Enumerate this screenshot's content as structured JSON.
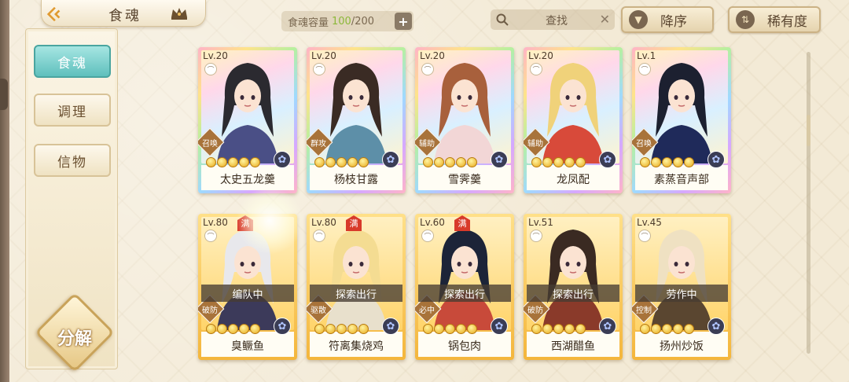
{
  "header": {
    "title": "食魂",
    "capacity_label": "食魂容量",
    "capacity_current": "100",
    "capacity_max": "/200",
    "search_placeholder": "查找",
    "sort_order_label": "降序",
    "sort_by_label": "稀有度"
  },
  "sidebar": {
    "tabs": [
      {
        "label": "食魂",
        "active": true
      },
      {
        "label": "调理",
        "active": false
      },
      {
        "label": "信物",
        "active": false
      }
    ],
    "decompose_label": "分解"
  },
  "cards": [
    {
      "name": "太史五龙羹",
      "level": "Lv.20",
      "role": "召唤",
      "frame": "rainbow",
      "stars": 5,
      "status": "",
      "full": false
    },
    {
      "name": "杨枝甘露",
      "level": "Lv.20",
      "role": "群攻",
      "frame": "rainbow",
      "stars": 5,
      "status": "",
      "full": false
    },
    {
      "name": "雪霁羹",
      "level": "Lv.20",
      "role": "辅助",
      "frame": "rainbow",
      "stars": 5,
      "status": "",
      "full": false
    },
    {
      "name": "龙凤配",
      "level": "Lv.20",
      "role": "辅助",
      "frame": "rainbow",
      "stars": 5,
      "status": "",
      "full": false
    },
    {
      "name": "素蒸音声部",
      "level": "Lv.1",
      "role": "召唤",
      "frame": "rainbow",
      "stars": 5,
      "status": "",
      "full": false
    },
    {
      "name": "臭鳜鱼",
      "level": "Lv.80",
      "role": "破防",
      "frame": "gold",
      "stars": 5,
      "status": "编队中",
      "full": true
    },
    {
      "name": "符离集烧鸡",
      "level": "Lv.80",
      "role": "驱散",
      "frame": "gold",
      "stars": 5,
      "status": "探索出行",
      "full": true
    },
    {
      "name": "锅包肉",
      "level": "Lv.60",
      "role": "必中",
      "frame": "gold",
      "stars": 5,
      "status": "探索出行",
      "full": true
    },
    {
      "name": "西湖醋鱼",
      "level": "Lv.51",
      "role": "破防",
      "frame": "gold",
      "stars": 5,
      "status": "探索出行",
      "full": false
    },
    {
      "name": "扬州炒饭",
      "level": "Lv.45",
      "role": "控制",
      "frame": "gold",
      "stars": 5,
      "status": "劳作中",
      "full": false
    }
  ],
  "full_badge_text": "满",
  "colors": {
    "active_tab": "#5fc0bd",
    "capacity_current": "#8cb83a",
    "full_badge": "#d83a2a"
  }
}
